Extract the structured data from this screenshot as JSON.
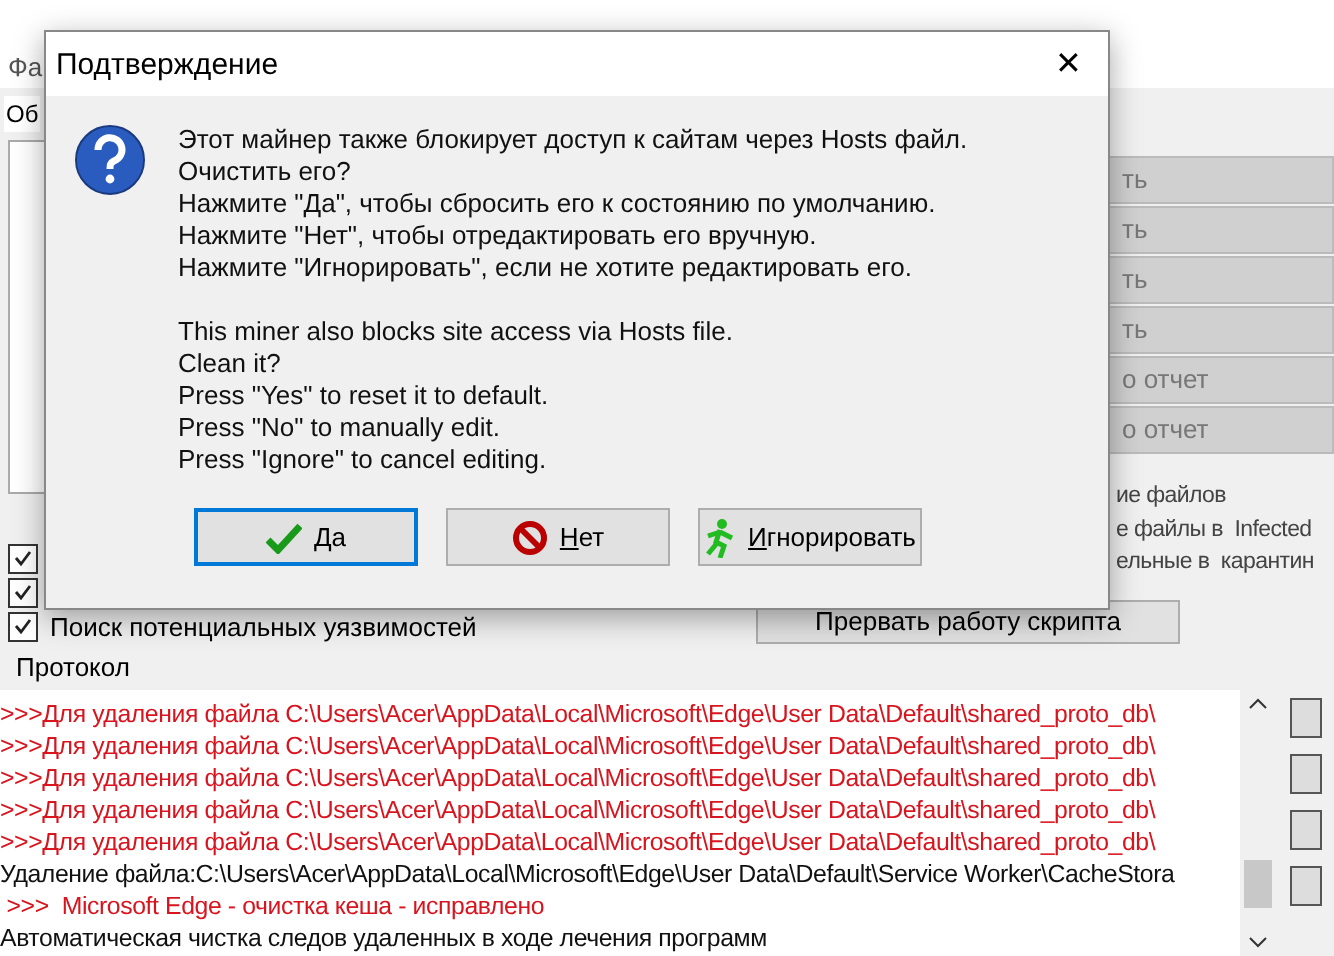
{
  "app": {
    "menu": [
      "Фа"
    ],
    "tabs": [
      {
        "label": "Об",
        "selected": true
      }
    ],
    "actions": [
      "ть",
      "ть",
      "ть",
      "ть",
      "о отчет",
      "о отчет"
    ],
    "options": [
      "ие файлов",
      "е файлы в  Infected",
      "ельные в  карантин"
    ],
    "checkboxes": [
      {
        "checked": true
      },
      {
        "checked": true
      },
      {
        "checked": true,
        "label": "Поиск потенциальных уязвимостей"
      }
    ],
    "stop_button": "Прервать работу скрипта",
    "log_title": "Протокол",
    "log": [
      {
        "kind": "alert",
        "text": ">>>Для удаления файла C:\\Users\\Acer\\AppData\\Local\\Microsoft\\Edge\\User Data\\Default\\shared_proto_db\\"
      },
      {
        "kind": "alert",
        "text": ">>>Для удаления файла C:\\Users\\Acer\\AppData\\Local\\Microsoft\\Edge\\User Data\\Default\\shared_proto_db\\"
      },
      {
        "kind": "alert",
        "text": ">>>Для удаления файла C:\\Users\\Acer\\AppData\\Local\\Microsoft\\Edge\\User Data\\Default\\shared_proto_db\\"
      },
      {
        "kind": "alert",
        "text": ">>>Для удаления файла C:\\Users\\Acer\\AppData\\Local\\Microsoft\\Edge\\User Data\\Default\\shared_proto_db\\"
      },
      {
        "kind": "alert",
        "text": ">>>Для удаления файла C:\\Users\\Acer\\AppData\\Local\\Microsoft\\Edge\\User Data\\Default\\shared_proto_db\\"
      },
      {
        "kind": "info",
        "text": "Удаление файла:C:\\Users\\Acer\\AppData\\Local\\Microsoft\\Edge\\User Data\\Default\\Service Worker\\CacheStora"
      },
      {
        "kind": "alert",
        "text": " >>>  Microsoft Edge - очистка кеша - исправлено"
      },
      {
        "kind": "info",
        "text": "Автоматическая чистка следов удаленных в ходе лечения программ"
      }
    ]
  },
  "dialog": {
    "title": "Подтверждение",
    "close": "✕",
    "paragraphs": [
      [
        "Этот майнер также блокирует доступ к сайтам через Hosts файл.",
        "Очистить его?",
        "Нажмите \"Да\", чтобы сбросить его к состоянию по умолчанию.",
        "Нажмите \"Нет\", чтобы отредактировать его вручную.",
        "Нажмите \"Игнорировать\", если не хотите редактировать его."
      ],
      [
        "This miner also blocks site access via Hosts file.",
        "Clean it?",
        "Press \"Yes\" to reset it to default.",
        "Press \"No\" to manually edit.",
        "Press \"Ignore\" to cancel editing."
      ]
    ],
    "buttons": [
      {
        "label": "Да",
        "selected": true
      },
      {
        "label": "Нет",
        "selected": false
      },
      {
        "label": "Игнорировать",
        "selected": false
      }
    ]
  }
}
